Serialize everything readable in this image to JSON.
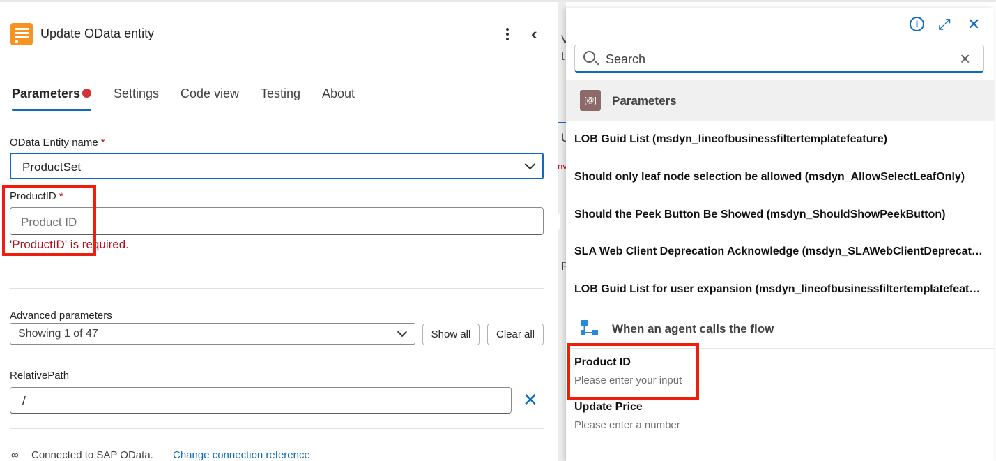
{
  "header": {
    "title": "Update OData entity"
  },
  "tabs": [
    {
      "label": "Parameters",
      "active": true,
      "has_error": true
    },
    {
      "label": "Settings"
    },
    {
      "label": "Code view"
    },
    {
      "label": "Testing"
    },
    {
      "label": "About"
    }
  ],
  "fields": {
    "entity_name": {
      "label": "OData Entity name",
      "required_mark": "*",
      "value": "ProductSet"
    },
    "product_id": {
      "label": "ProductID",
      "required_mark": "*",
      "placeholder": "Product ID",
      "error": "'ProductID' is required."
    },
    "advanced": {
      "label": "Advanced parameters",
      "value": "Showing 1 of 47",
      "show_all": "Show all",
      "clear_all": "Clear all"
    },
    "relative_path": {
      "label": "RelativePath",
      "value": "/"
    }
  },
  "footer": {
    "connected_text": "Connected to SAP OData.",
    "change_link": "Change connection reference"
  },
  "sliver_text": [
    "V",
    "t",
    "U",
    "nv",
    "R"
  ],
  "dynamic_panel": {
    "search_placeholder": "Search",
    "parameters_section": {
      "title": "Parameters",
      "icon_text": "[@]",
      "items": [
        "LOB Guid List (msdyn_lineofbusinessfiltertemplatefeature)",
        "Should only leaf node selection be allowed (msdyn_AllowSelectLeafOnly)",
        "Should the Peek Button Be Showed (msdyn_ShouldShowPeekButton)",
        "SLA Web Client Deprecation Acknowledge (msdyn_SLAWebClientDeprecationAcknowledge)",
        "LOB Guid List for user expansion (msdyn_lineofbusinessfiltertemplatefeatureforuserexpansion)"
      ]
    },
    "trigger_section": {
      "title": "When an agent calls the flow",
      "items": [
        {
          "title": "Product ID",
          "subtitle": "Please enter your input"
        },
        {
          "title": "Update Price",
          "subtitle": "Please enter a number"
        }
      ]
    }
  },
  "colors": {
    "accent": "#0f6cbd",
    "error": "#b10e1c",
    "highlight_box": "#ee1d0e",
    "app_icon": "#f7931e"
  }
}
